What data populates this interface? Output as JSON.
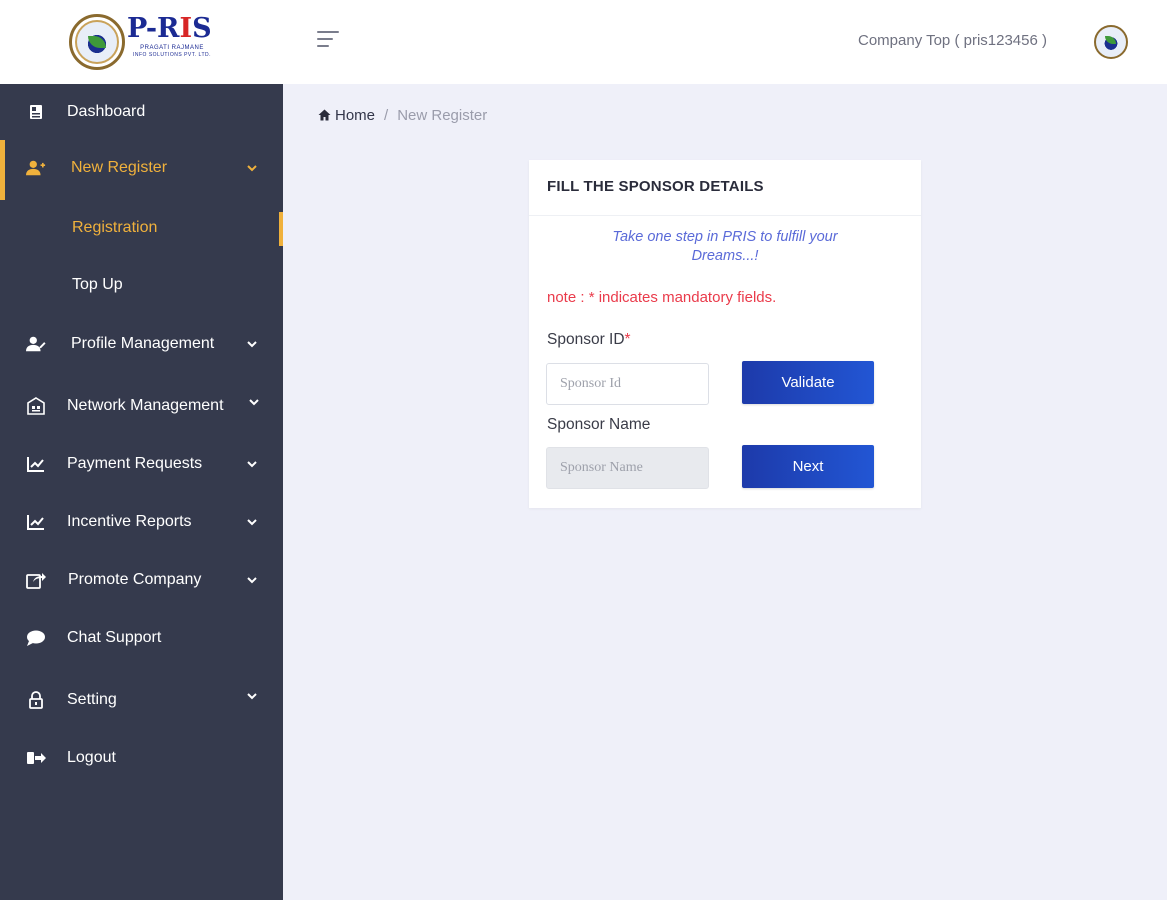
{
  "brand": {
    "name_left": "P-R",
    "name_dot": "I",
    "name_right": "S",
    "sub1": "PRAGATI RAJMANE",
    "sub2": "INFO SOLUTIONS PVT. LTD."
  },
  "colors": {
    "sidebar_bg": "#353a4d",
    "accent": "#f0b13c",
    "primary_button": "#1d3aaa",
    "mandatory": "#ea3b4b",
    "tagline": "#5a6ad8",
    "page_bg": "#eff0f9"
  },
  "sidebar": {
    "items": [
      {
        "label": "Dashboard",
        "icon": "dashboard-icon",
        "has_chevron": false
      },
      {
        "label": "New Register",
        "icon": "add-user-icon",
        "has_chevron": true,
        "active": true
      },
      {
        "label": "Registration",
        "sub": true,
        "active": true
      },
      {
        "label": "Top Up",
        "sub": true
      },
      {
        "label": "Profile Management",
        "icon": "user-edit-icon",
        "has_chevron": true
      },
      {
        "label": "Network Management",
        "icon": "network-icon",
        "has_chevron": true
      },
      {
        "label": "Payment Requests",
        "icon": "chart-icon",
        "has_chevron": true
      },
      {
        "label": "Incentive Reports",
        "icon": "chart-icon",
        "has_chevron": true
      },
      {
        "label": "Promote Company",
        "icon": "share-icon",
        "has_chevron": true
      },
      {
        "label": "Chat Support",
        "icon": "chat-icon",
        "has_chevron": false
      },
      {
        "label": "Setting",
        "icon": "lock-icon",
        "has_chevron": true
      },
      {
        "label": "Logout",
        "icon": "logout-icon",
        "has_chevron": false
      }
    ]
  },
  "header": {
    "company": "Company Top ( pris123456 )"
  },
  "breadcrumb": {
    "home": "Home",
    "separator": "/",
    "current": "New Register"
  },
  "card": {
    "title": "FILL THE SPONSOR DETAILS",
    "tagline": "Take one step in PRIS to fulfill your Dreams...!",
    "note": "note : * indicates mandatory fields.",
    "sponsor_id_label": "Sponsor ID",
    "sponsor_id_required": "*",
    "sponsor_id_placeholder": "Sponsor Id",
    "validate_label": "Validate",
    "sponsor_name_label": "Sponsor Name",
    "sponsor_name_placeholder": "Sponsor Name",
    "next_label": "Next"
  }
}
